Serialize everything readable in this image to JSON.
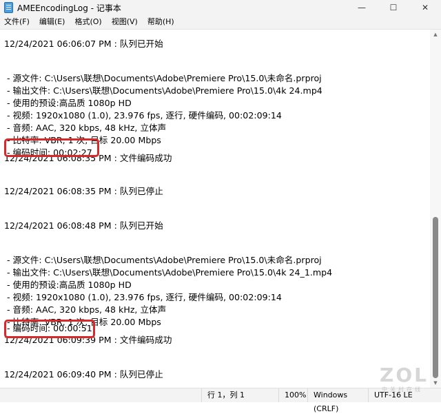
{
  "window": {
    "title": "AMEEncodingLog - 记事本",
    "minimize_glyph": "—",
    "maximize_glyph": "☐",
    "close_glyph": "✕"
  },
  "menu": [
    "文件(F)",
    "编辑(E)",
    "格式(O)",
    "视图(V)",
    "帮助(H)"
  ],
  "lines": [
    "12/24/2021 06:06:07 PM : 队列已开始",
    " - 源文件: C:\\Users\\联想\\Documents\\Adobe\\Premiere Pro\\15.0\\未命名.prproj",
    " - 输出文件: C:\\Users\\联想\\Documents\\Adobe\\Premiere Pro\\15.0\\4k 24.mp4",
    " - 使用的预设:高品质 1080p HD",
    " - 视频: 1920x1080 (1.0), 23.976 fps, 逐行, 硬件编码, 00:02:09:14",
    " - 音频: AAC, 320 kbps, 48 kHz, 立体声",
    " - 比特率: VBR, 1 次, 目标 20.00 Mbps",
    " - 编码时间: 00:02:27",
    "12/24/2021 06:08:35 PM : 文件编码成功",
    "12/24/2021 06:08:35 PM : 队列已停止",
    "12/24/2021 06:08:48 PM : 队列已开始",
    " - 源文件: C:\\Users\\联想\\Documents\\Adobe\\Premiere Pro\\15.0\\未命名.prproj",
    " - 输出文件: C:\\Users\\联想\\Documents\\Adobe\\Premiere Pro\\15.0\\4k 24_1.mp4",
    " - 使用的预设:高品质 1080p HD",
    " - 视频: 1920x1080 (1.0), 23.976 fps, 逐行, 硬件编码, 00:02:09:14",
    " - 音频: AAC, 320 kbps, 48 kHz, 立体声",
    " - 比特率: VBR, 1 次, 目标 20.00 Mbps",
    " - 编码时间: 00:00:51",
    "12/24/2021 06:09:39 PM : 文件编码成功",
    "12/24/2021 06:09:40 PM : 队列已停止"
  ],
  "status": {
    "position": "行 1，列 1",
    "zoom": "100%",
    "line_ending": "Windows (CRLF)",
    "encoding": "UTF-16 LE"
  },
  "watermark": {
    "logo": "ZOL",
    "sub": "中关村在线"
  },
  "colors": {
    "highlight": "#d8282a",
    "chrome": "#f3f3f3"
  }
}
